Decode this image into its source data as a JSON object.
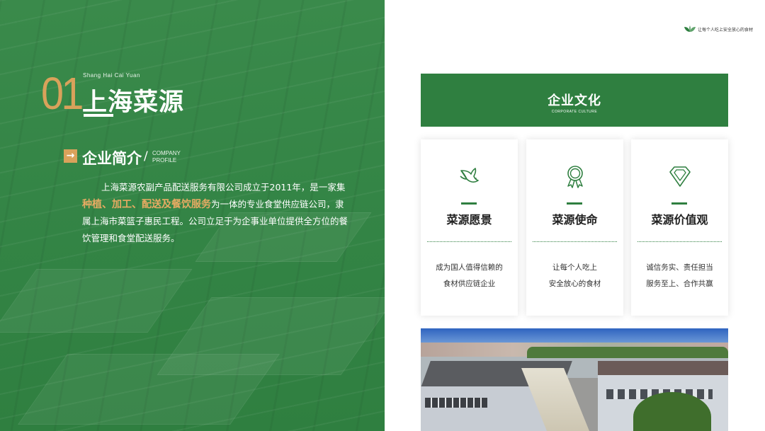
{
  "left": {
    "number": "01",
    "pinyin": "Shang Hai Cai Yuan",
    "title": "上海菜源",
    "subtitle": "企业简介",
    "subtitle_slash": "/",
    "subtitle_en": "COMPANY PROFILE",
    "arrow_icon": "arrow-right-icon",
    "intro_part1": "上海菜源农副产品配送服务有限公司成立于2011年，是一家集",
    "intro_highlight": "种植、加工、配送及餐饮服务",
    "intro_part2": "为一体的专业食堂供应链公司，隶属上海市菜篮子惠民工程。公司立足于为企事业单位提供全方位的餐饮管理和食堂配送服务。"
  },
  "right": {
    "slogan": "让每个人吃上安全放心的食材",
    "culture_title": "企业文化",
    "culture_en": "CORPORATE CULTURE",
    "cards": [
      {
        "icon": "dove-icon",
        "title": "菜源愿景",
        "line1": "成为国人值得信赖的",
        "line2": "食材供应链企业"
      },
      {
        "icon": "medal-icon",
        "title": "菜源使命",
        "line1": "让每个人吃上",
        "line2": "安全放心的食材"
      },
      {
        "icon": "diamond-icon",
        "title": "菜源价值观",
        "line1": "诚信务实、责任担当",
        "line2": "服务至上、合作共赢"
      }
    ]
  },
  "colors": {
    "brand_green": "#2f7f40",
    "accent_gold": "#d9a25b",
    "highlight_orange": "#e8ab63"
  }
}
